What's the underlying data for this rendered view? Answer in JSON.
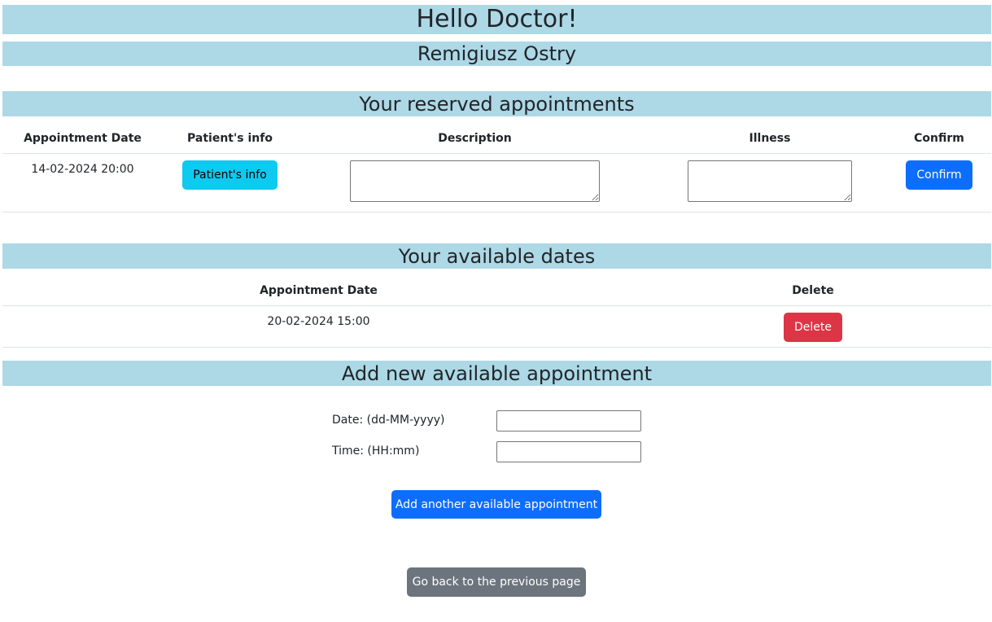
{
  "header": {
    "greeting": "Hello Doctor!",
    "doctor_name": "Remigiusz Ostry"
  },
  "reserved": {
    "title": "Your reserved appointments",
    "columns": [
      "Appointment Date",
      "Patient's info",
      "Description",
      "Illness",
      "Confirm"
    ],
    "rows": [
      {
        "date": "14-02-2024 20:00",
        "patient_button": "Patient's info",
        "description": "",
        "illness": "",
        "confirm_button": "Confirm"
      }
    ]
  },
  "available": {
    "title": "Your available dates",
    "columns": [
      "Appointment Date",
      "Delete"
    ],
    "rows": [
      {
        "date": "20-02-2024 15:00",
        "delete_button": "Delete"
      }
    ]
  },
  "add_form": {
    "title": "Add new available appointment",
    "date_label": "Date: (dd-MM-yyyy)",
    "date_value": "",
    "time_label": "Time: (HH:mm)",
    "time_value": "",
    "submit_button": "Add another available appointment"
  },
  "footer": {
    "back_button": "Go back to the previous page"
  },
  "colors": {
    "banner": "#add8e6",
    "primary": "#0d6efd",
    "info": "#0dcaf0",
    "danger": "#dc3545",
    "secondary": "#6c757d"
  }
}
